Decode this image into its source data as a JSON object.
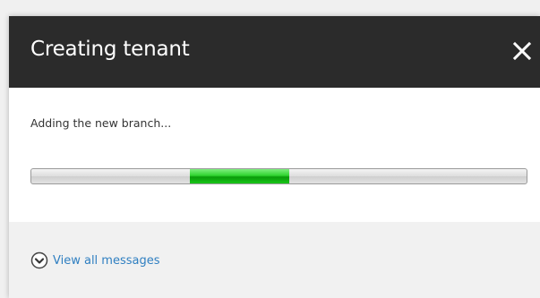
{
  "dialog": {
    "title": "Creating tenant",
    "close_icon": "close-icon",
    "status_text": "Adding the new branch...",
    "progress": {
      "indeterminate": true,
      "segment_start_percent": 32,
      "segment_end_percent": 52,
      "fill_color": "#1fcf1f"
    },
    "footer": {
      "link_label": "View all messages",
      "link_icon": "chevron-down-circle-icon",
      "link_color": "#2f7fc1"
    }
  }
}
